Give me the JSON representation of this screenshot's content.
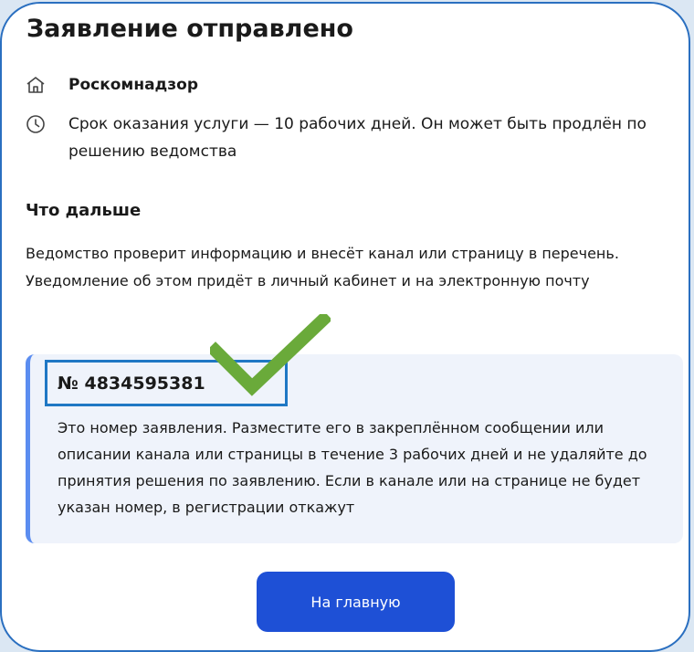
{
  "page": {
    "title": "Заявление отправлено"
  },
  "agency": {
    "icon": "home-icon",
    "name": "Роскомнадзор"
  },
  "deadline": {
    "icon": "clock-icon",
    "text": "Срок оказания услуги — 10 рабочих дней. Он может быть продлён по решению ведомства"
  },
  "next_steps": {
    "heading": "Что дальше",
    "text": "Ведомство проверит информацию и внесёт канал или страницу в перечень. Уведомление об этом придёт в личный кабинет и на электронную почту"
  },
  "application": {
    "number": "№ 4834595381",
    "description": "Это номер заявления. Разместите его в закреплённом сообщении или описании канала или страницы в течение 3 рабочих дней и не удаляйте до принятия решения по заявлению. Если в канале или на странице не будет указан номер, в регистрации откажут",
    "annotation_icon": "checkmark-icon"
  },
  "actions": {
    "home_button": "На главную"
  },
  "colors": {
    "accent": "#1e50d6",
    "info_box_bg": "#eff3fb",
    "info_box_border": "#5b8df0",
    "highlight_frame": "#1f77c4",
    "checkmark": "#6aaa3a",
    "card_border": "#2a6fc0"
  }
}
